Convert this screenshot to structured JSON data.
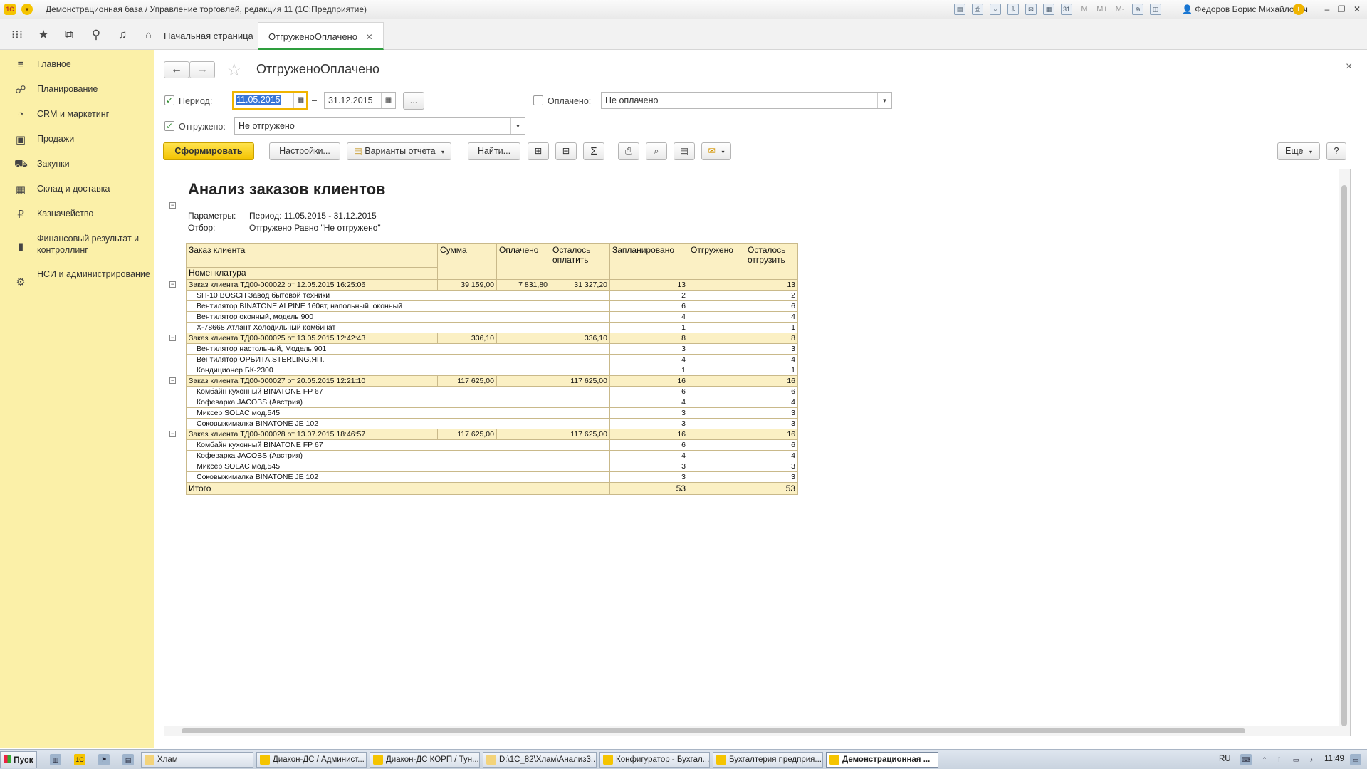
{
  "window": {
    "title": "Демонстрационная база / Управление торговлей, редакция 11  (1С:Предприятие)",
    "user": "Федоров Борис Михайлович",
    "app_logo": "1С",
    "toolbar_letters": [
      "M",
      "M+",
      "M-"
    ],
    "minimize": "–",
    "restore": "❐",
    "close": "✕"
  },
  "tabs": {
    "home_label": "Начальная страница",
    "active_label": "ОтгруженоОплачено",
    "active_close": "✕"
  },
  "sidebar": {
    "items": [
      {
        "label": "Главное",
        "icon": "≡"
      },
      {
        "label": "Планирование",
        "icon": "☍"
      },
      {
        "label": "CRM и маркетинг",
        "icon": "◔"
      },
      {
        "label": "Продажи",
        "icon": "▣"
      },
      {
        "label": "Закупки",
        "icon": "⛟"
      },
      {
        "label": "Склад и доставка",
        "icon": "▦"
      },
      {
        "label": "Казначейство",
        "icon": "₽"
      },
      {
        "label": "Финансовый результат и контроллинг",
        "icon": "▮"
      },
      {
        "label": "НСИ и администрирование",
        "icon": "⚙"
      }
    ]
  },
  "form": {
    "title": "ОтгруженоОплачено",
    "back": "←",
    "forward": "→",
    "star": "☆",
    "close": "×",
    "period_label": "Период:",
    "period_from": "11.05.2015",
    "period_dash": "–",
    "period_to": "31.12.2015",
    "period_more": "...",
    "paid_label": "Оплачено:",
    "paid_value": "Не оплачено",
    "shipped_label": "Отгружено:",
    "shipped_value": "Не отгружено",
    "check_mark": "✓",
    "calendar_glyph": "▦",
    "dropdown_glyph": "▾"
  },
  "commandbar": {
    "generate": "Сформировать",
    "settings": "Настройки...",
    "variants": "Варианты отчета",
    "find": "Найти...",
    "sum_glyph": "Σ",
    "print_glyph": "⎙",
    "preview_glyph": "⌕",
    "save_glyph": "▤",
    "mail_glyph": "✉",
    "expand_glyph": "⊞",
    "collapse_glyph": "⊟",
    "more": "Еще",
    "help": "?"
  },
  "report": {
    "title": "Анализ заказов клиентов",
    "params_label": "Параметры:",
    "params_value": "Период: 11.05.2015 - 31.12.2015",
    "filter_label": "Отбор:",
    "filter_value": "Отгружено Равно \"Не отгружено\"",
    "header": {
      "order": "Заказ клиента",
      "nomenclature": "Номенклатура",
      "sum": "Сумма",
      "paid": "Оплачено",
      "left_to_pay": "Осталось оплатить",
      "planned": "Запланировано",
      "shipped": "Отгружено",
      "left_to_ship": "Осталось отгрузить"
    },
    "groups": [
      {
        "order": "Заказ клиента ТД00-000022 от 12.05.2015 16:25:06",
        "sum": "39 159,00",
        "paid": "7 831,80",
        "left_to_pay": "31 327,20",
        "planned": "13",
        "shipped": "",
        "left_to_ship": "13",
        "items": [
          {
            "name": "SH-10 BOSCH Завод бытовой техники",
            "planned": "2",
            "left_to_ship": "2"
          },
          {
            "name": "Вентилятор BINATONE ALPINE 160вт, напольный, оконный",
            "planned": "6",
            "left_to_ship": "6"
          },
          {
            "name": "Вентилятор оконный, модель 900",
            "planned": "4",
            "left_to_ship": "4"
          },
          {
            "name": "X-78668 Атлант Холодильный комбинат",
            "planned": "1",
            "left_to_ship": "1"
          }
        ]
      },
      {
        "order": "Заказ клиента ТД00-000025 от 13.05.2015 12:42:43",
        "sum": "336,10",
        "paid": "",
        "left_to_pay": "336,10",
        "planned": "8",
        "shipped": "",
        "left_to_ship": "8",
        "items": [
          {
            "name": "Вентилятор настольный, Модель 901",
            "planned": "3",
            "left_to_ship": "3"
          },
          {
            "name": "Вентилятор ОРБИТА,STERLING,ЯП.",
            "planned": "4",
            "left_to_ship": "4"
          },
          {
            "name": "Кондиционер БК-2300",
            "planned": "1",
            "left_to_ship": "1"
          }
        ]
      },
      {
        "order": "Заказ клиента ТД00-000027 от 20.05.2015 12:21:10",
        "sum": "117 625,00",
        "paid": "",
        "left_to_pay": "117 625,00",
        "planned": "16",
        "shipped": "",
        "left_to_ship": "16",
        "items": [
          {
            "name": "Комбайн кухонный BINATONE FP 67",
            "planned": "6",
            "left_to_ship": "6"
          },
          {
            "name": "Кофеварка JACOBS (Австрия)",
            "planned": "4",
            "left_to_ship": "4"
          },
          {
            "name": "Миксер SOLAC мод.545",
            "planned": "3",
            "left_to_ship": "3"
          },
          {
            "name": "Соковыжималка  BINATONE JE 102",
            "planned": "3",
            "left_to_ship": "3"
          }
        ]
      },
      {
        "order": "Заказ клиента ТД00-000028 от 13.07.2015 18:46:57",
        "sum": "117 625,00",
        "paid": "",
        "left_to_pay": "117 625,00",
        "planned": "16",
        "shipped": "",
        "left_to_ship": "16",
        "items": [
          {
            "name": "Комбайн кухонный BINATONE FP 67",
            "planned": "6",
            "left_to_ship": "6"
          },
          {
            "name": "Кофеварка JACOBS (Австрия)",
            "planned": "4",
            "left_to_ship": "4"
          },
          {
            "name": "Миксер SOLAC мод.545",
            "planned": "3",
            "left_to_ship": "3"
          },
          {
            "name": "Соковыжималка  BINATONE JE 102",
            "planned": "3",
            "left_to_ship": "3"
          }
        ]
      }
    ],
    "total": {
      "label": "Итого",
      "planned": "53",
      "left_to_ship": "53"
    }
  },
  "taskbar": {
    "start": "Пуск",
    "tasks": [
      {
        "label": "Хлам"
      },
      {
        "label": "Диакон-ДС / Админист..."
      },
      {
        "label": "Диакон-ДС КОРП / Тун..."
      },
      {
        "label": "D:\\1C_82\\Хлам\\Анализ3..."
      },
      {
        "label": "Конфигуратор - Бухгал..."
      },
      {
        "label": "Бухгалтерия предприя..."
      },
      {
        "label": "Демонстрационная ..."
      }
    ],
    "lang": "RU",
    "time": "11:49"
  },
  "colors": {
    "sidebar_bg": "#fbf0a8",
    "accent_yellow": "#f4c300",
    "report_header_bg": "#fbf0c4",
    "active_tab_underline": "#2e9e3e"
  }
}
